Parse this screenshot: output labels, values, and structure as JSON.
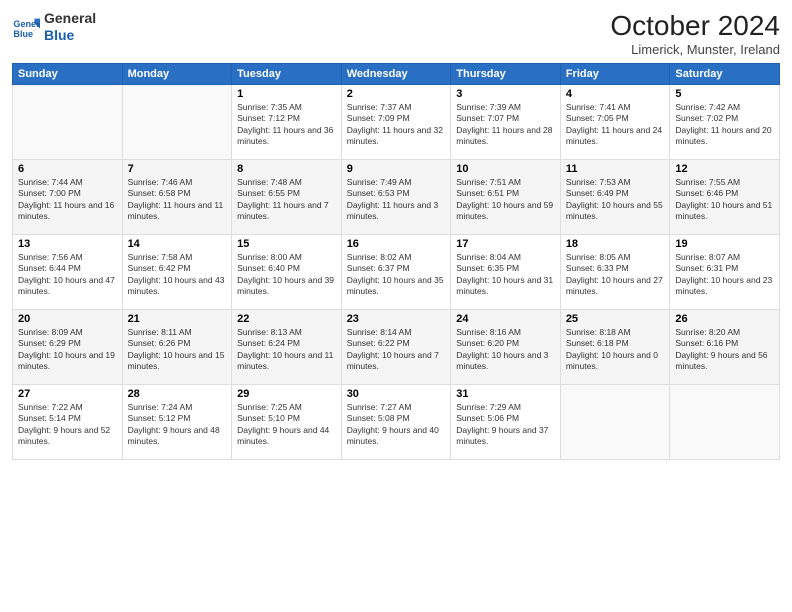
{
  "logo": {
    "line1": "General",
    "line2": "Blue"
  },
  "title": "October 2024",
  "subtitle": "Limerick, Munster, Ireland",
  "weekdays": [
    "Sunday",
    "Monday",
    "Tuesday",
    "Wednesday",
    "Thursday",
    "Friday",
    "Saturday"
  ],
  "weeks": [
    [
      {
        "day": "",
        "info": ""
      },
      {
        "day": "",
        "info": ""
      },
      {
        "day": "1",
        "info": "Sunrise: 7:35 AM\nSunset: 7:12 PM\nDaylight: 11 hours and 36 minutes."
      },
      {
        "day": "2",
        "info": "Sunrise: 7:37 AM\nSunset: 7:09 PM\nDaylight: 11 hours and 32 minutes."
      },
      {
        "day": "3",
        "info": "Sunrise: 7:39 AM\nSunset: 7:07 PM\nDaylight: 11 hours and 28 minutes."
      },
      {
        "day": "4",
        "info": "Sunrise: 7:41 AM\nSunset: 7:05 PM\nDaylight: 11 hours and 24 minutes."
      },
      {
        "day": "5",
        "info": "Sunrise: 7:42 AM\nSunset: 7:02 PM\nDaylight: 11 hours and 20 minutes."
      }
    ],
    [
      {
        "day": "6",
        "info": "Sunrise: 7:44 AM\nSunset: 7:00 PM\nDaylight: 11 hours and 16 minutes."
      },
      {
        "day": "7",
        "info": "Sunrise: 7:46 AM\nSunset: 6:58 PM\nDaylight: 11 hours and 11 minutes."
      },
      {
        "day": "8",
        "info": "Sunrise: 7:48 AM\nSunset: 6:55 PM\nDaylight: 11 hours and 7 minutes."
      },
      {
        "day": "9",
        "info": "Sunrise: 7:49 AM\nSunset: 6:53 PM\nDaylight: 11 hours and 3 minutes."
      },
      {
        "day": "10",
        "info": "Sunrise: 7:51 AM\nSunset: 6:51 PM\nDaylight: 10 hours and 59 minutes."
      },
      {
        "day": "11",
        "info": "Sunrise: 7:53 AM\nSunset: 6:49 PM\nDaylight: 10 hours and 55 minutes."
      },
      {
        "day": "12",
        "info": "Sunrise: 7:55 AM\nSunset: 6:46 PM\nDaylight: 10 hours and 51 minutes."
      }
    ],
    [
      {
        "day": "13",
        "info": "Sunrise: 7:56 AM\nSunset: 6:44 PM\nDaylight: 10 hours and 47 minutes."
      },
      {
        "day": "14",
        "info": "Sunrise: 7:58 AM\nSunset: 6:42 PM\nDaylight: 10 hours and 43 minutes."
      },
      {
        "day": "15",
        "info": "Sunrise: 8:00 AM\nSunset: 6:40 PM\nDaylight: 10 hours and 39 minutes."
      },
      {
        "day": "16",
        "info": "Sunrise: 8:02 AM\nSunset: 6:37 PM\nDaylight: 10 hours and 35 minutes."
      },
      {
        "day": "17",
        "info": "Sunrise: 8:04 AM\nSunset: 6:35 PM\nDaylight: 10 hours and 31 minutes."
      },
      {
        "day": "18",
        "info": "Sunrise: 8:05 AM\nSunset: 6:33 PM\nDaylight: 10 hours and 27 minutes."
      },
      {
        "day": "19",
        "info": "Sunrise: 8:07 AM\nSunset: 6:31 PM\nDaylight: 10 hours and 23 minutes."
      }
    ],
    [
      {
        "day": "20",
        "info": "Sunrise: 8:09 AM\nSunset: 6:29 PM\nDaylight: 10 hours and 19 minutes."
      },
      {
        "day": "21",
        "info": "Sunrise: 8:11 AM\nSunset: 6:26 PM\nDaylight: 10 hours and 15 minutes."
      },
      {
        "day": "22",
        "info": "Sunrise: 8:13 AM\nSunset: 6:24 PM\nDaylight: 10 hours and 11 minutes."
      },
      {
        "day": "23",
        "info": "Sunrise: 8:14 AM\nSunset: 6:22 PM\nDaylight: 10 hours and 7 minutes."
      },
      {
        "day": "24",
        "info": "Sunrise: 8:16 AM\nSunset: 6:20 PM\nDaylight: 10 hours and 3 minutes."
      },
      {
        "day": "25",
        "info": "Sunrise: 8:18 AM\nSunset: 6:18 PM\nDaylight: 10 hours and 0 minutes."
      },
      {
        "day": "26",
        "info": "Sunrise: 8:20 AM\nSunset: 6:16 PM\nDaylight: 9 hours and 56 minutes."
      }
    ],
    [
      {
        "day": "27",
        "info": "Sunrise: 7:22 AM\nSunset: 5:14 PM\nDaylight: 9 hours and 52 minutes."
      },
      {
        "day": "28",
        "info": "Sunrise: 7:24 AM\nSunset: 5:12 PM\nDaylight: 9 hours and 48 minutes."
      },
      {
        "day": "29",
        "info": "Sunrise: 7:25 AM\nSunset: 5:10 PM\nDaylight: 9 hours and 44 minutes."
      },
      {
        "day": "30",
        "info": "Sunrise: 7:27 AM\nSunset: 5:08 PM\nDaylight: 9 hours and 40 minutes."
      },
      {
        "day": "31",
        "info": "Sunrise: 7:29 AM\nSunset: 5:06 PM\nDaylight: 9 hours and 37 minutes."
      },
      {
        "day": "",
        "info": ""
      },
      {
        "day": "",
        "info": ""
      }
    ]
  ]
}
